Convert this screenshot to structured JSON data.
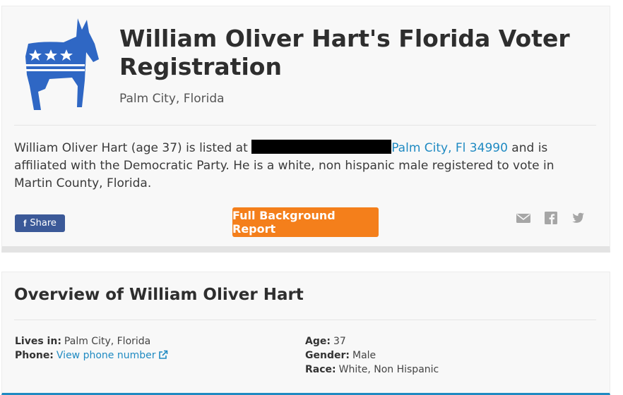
{
  "colors": {
    "donkey_blue": "#2f67c4",
    "share_blue": "#3b5998",
    "report_orange": "#f47f1b",
    "link_blue": "#1f8ac2"
  },
  "header": {
    "title": "William Oliver Hart's Florida Voter Registration",
    "subtitle": "Palm City, Florida"
  },
  "description": {
    "lead": "William Oliver Hart (age 37) is listed at ",
    "address_link": "Palm City, Fl 34990",
    "tail": " and is affiliated with the Democratic Party. He is a white, non hispanic male registered to vote in Martin County, Florida."
  },
  "actions": {
    "share_icon": "f",
    "share_label": "Share",
    "report_label": "Full Background Report",
    "social_icons": [
      "email-icon",
      "facebook-icon",
      "twitter-icon"
    ]
  },
  "overview": {
    "title": "Overview of William Oliver Hart",
    "lives_in_label": "Lives in:",
    "lives_in_value": "Palm City, Florida",
    "phone_label": "Phone:",
    "phone_link": "View phone number",
    "age_label": "Age:",
    "age_value": "37",
    "gender_label": "Gender:",
    "gender_value": "Male",
    "race_label": "Race:",
    "race_value": "White, Non Hispanic"
  }
}
